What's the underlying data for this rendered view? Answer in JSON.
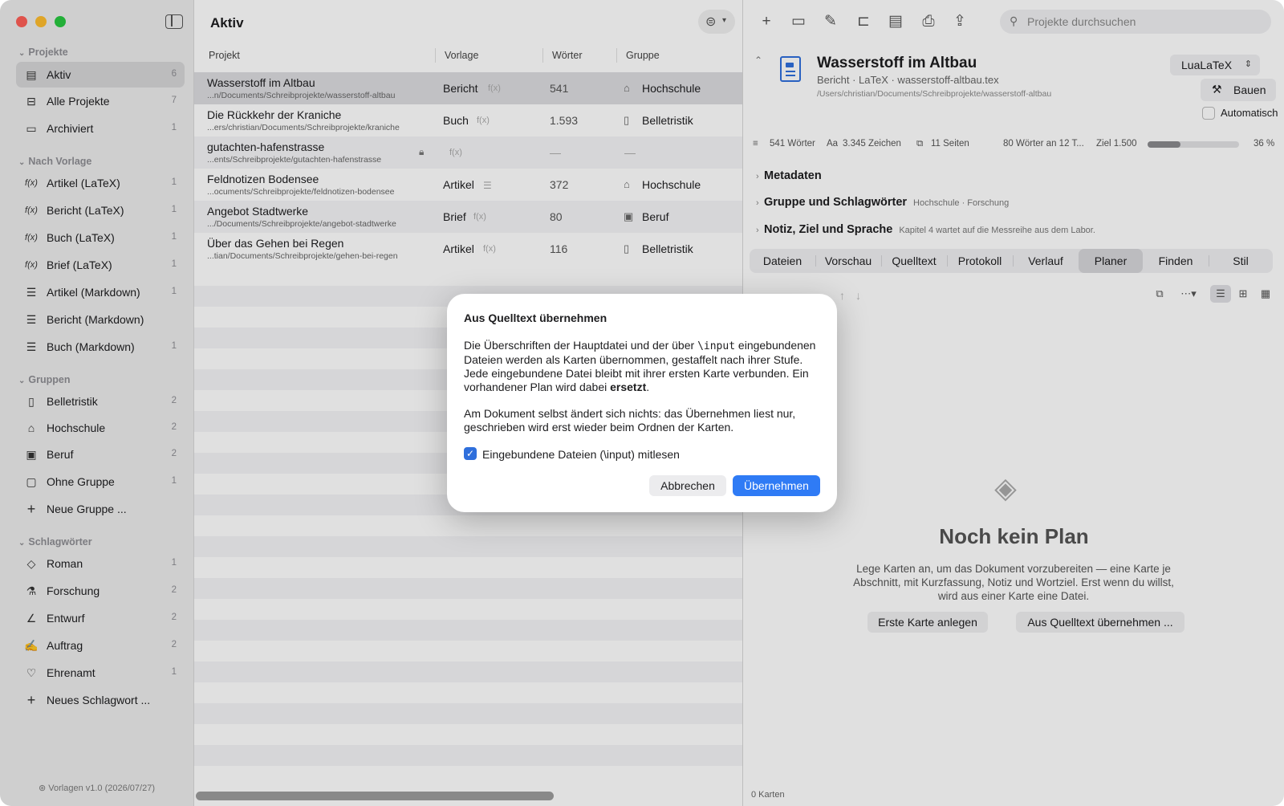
{
  "sidebar": {
    "sections": [
      {
        "title": "Projekte",
        "items": [
          {
            "label": "Aktiv",
            "count": "6"
          },
          {
            "label": "Alle Projekte",
            "count": "7"
          },
          {
            "label": "Archiviert",
            "count": "1"
          }
        ]
      },
      {
        "title": "Nach Vorlage",
        "items": [
          {
            "label": "Artikel (LaTeX)",
            "count": "1"
          },
          {
            "label": "Bericht (LaTeX)",
            "count": "1"
          },
          {
            "label": "Buch (LaTeX)",
            "count": "1"
          },
          {
            "label": "Brief (LaTeX)",
            "count": "1"
          },
          {
            "label": "Artikel (Markdown)",
            "count": "1"
          },
          {
            "label": "Bericht (Markdown)",
            "count": ""
          },
          {
            "label": "Buch (Markdown)",
            "count": "1"
          }
        ]
      },
      {
        "title": "Gruppen",
        "items": [
          {
            "label": "Belletristik",
            "count": "2"
          },
          {
            "label": "Hochschule",
            "count": "2"
          },
          {
            "label": "Beruf",
            "count": "2"
          },
          {
            "label": "Ohne Gruppe",
            "count": "1"
          },
          {
            "label": "Neue Gruppe ...",
            "count": ""
          }
        ]
      },
      {
        "title": "Schlagwörter",
        "items": [
          {
            "label": "Roman",
            "count": "1"
          },
          {
            "label": "Forschung",
            "count": "2"
          },
          {
            "label": "Entwurf",
            "count": "2"
          },
          {
            "label": "Auftrag",
            "count": "2"
          },
          {
            "label": "Ehrenamt",
            "count": "1"
          },
          {
            "label": "Neues Schlagwort ...",
            "count": ""
          }
        ]
      }
    ],
    "footer": "Vorlagen v1.0 (2026/07/27)"
  },
  "middle": {
    "title": "Aktiv",
    "columns": {
      "projekt": "Projekt",
      "vorlage": "Vorlage",
      "woerter": "Wörter",
      "gruppe": "Gruppe"
    },
    "rows": [
      {
        "name": "Wasserstoff im Altbau",
        "path": "...n/Documents/Schreibprojekte/wasserstoff-altbau",
        "vorlage": "Bericht",
        "vicon": "f(x)",
        "words": "541",
        "group": "Hochschule",
        "gicon": "graduation-cap-icon"
      },
      {
        "name": "Die Rückkehr der Kraniche",
        "path": "...ers/christian/Documents/Schreibprojekte/kraniche",
        "vorlage": "Buch",
        "vicon": "f(x)",
        "words": "1.593",
        "group": "Belletristik",
        "gicon": "book-icon"
      },
      {
        "name": "gutachten-hafenstrasse",
        "path": "...ents/Schreibprojekte/gutachten-hafenstrasse",
        "vorlage": "",
        "vicon": "f(x)",
        "words": "—",
        "group": "—",
        "gicon": ""
      },
      {
        "name": "Feldnotizen Bodensee",
        "path": "...ocuments/Schreibprojekte/feldnotizen-bodensee",
        "vorlage": "Artikel",
        "vicon": "markdown",
        "words": "372",
        "group": "Hochschule",
        "gicon": "graduation-cap-icon"
      },
      {
        "name": "Angebot Stadtwerke",
        "path": ".../Documents/Schreibprojekte/angebot-stadtwerke",
        "vorlage": "Brief",
        "vicon": "f(x)",
        "words": "80",
        "group": "Beruf",
        "gicon": "briefcase-icon"
      },
      {
        "name": "Über das Gehen bei Regen",
        "path": "...tian/Documents/Schreibprojekte/gehen-bei-regen",
        "vorlage": "Artikel",
        "vicon": "f(x)",
        "words": "116",
        "group": "Belletristik",
        "gicon": "book-icon"
      }
    ]
  },
  "right": {
    "search_placeholder": "Projekte durchsuchen",
    "project_title": "Wasserstoff im Altbau",
    "project_sub": "Bericht · LaTeX · wasserstoff-altbau.tex",
    "project_path": "/Users/christian/Documents/Schreibprojekte/wasserstoff-altbau",
    "engine": "LuaLaTeX",
    "build_label": "Bauen",
    "auto_label": "Automatisch",
    "stats": {
      "words": "541 Wörter",
      "chars": "3.345 Zeichen",
      "pages": "11 Seiten",
      "rate": "80 Wörter an 12 T...",
      "goal": "Ziel 1.500",
      "percent": "36 %",
      "progress": 0.36
    },
    "meta_label": "Metadaten",
    "group_label": "Gruppe und Schlagwörter",
    "group_note": "Hochschule · Forschung",
    "note_label": "Notiz, Ziel und Sprache",
    "note_note": "Kapitel 4 wartet auf die Messreihe aus dem Labor.",
    "tabs": [
      "Dateien",
      "Vorschau",
      "Quelltext",
      "Protokoll",
      "Verlauf",
      "Planer",
      "Finden",
      "Stil"
    ],
    "empty_title": "Noch kein Plan",
    "empty_text": "Lege Karten an, um das Dokument vorzubereiten — eine Karte je Abschnitt, mit Kurzfassung, Notiz und Wortziel. Erst wenn du willst, wird aus einer Karte eine Datei.",
    "btn_first_card": "Erste Karte anlegen",
    "btn_from_source": "Aus Quelltext übernehmen ...",
    "cards_count": "0 Karten"
  },
  "dialog": {
    "title": "Aus Quelltext übernehmen",
    "p1_a": "Die Überschriften der Hauptdatei und der über ",
    "p1_code": "\\input",
    "p1_b": " eingebundenen Dateien werden als Karten übernommen, gestaffelt nach ihrer Stufe. Jede eingebundene Datei bleibt mit ihrer ersten Karte verbunden. Ein vorhandener Plan wird dabei ",
    "p1_bold": "ersetzt",
    "p1_c": ".",
    "p2": "Am Dokument selbst ändert sich nichts: das Übernehmen liest nur, geschrieben wird erst wieder beim Ordnen der Karten.",
    "checkbox_label": "Eingebundene Dateien (\\input) mitlesen",
    "cancel": "Abbrechen",
    "ok": "Übernehmen"
  }
}
